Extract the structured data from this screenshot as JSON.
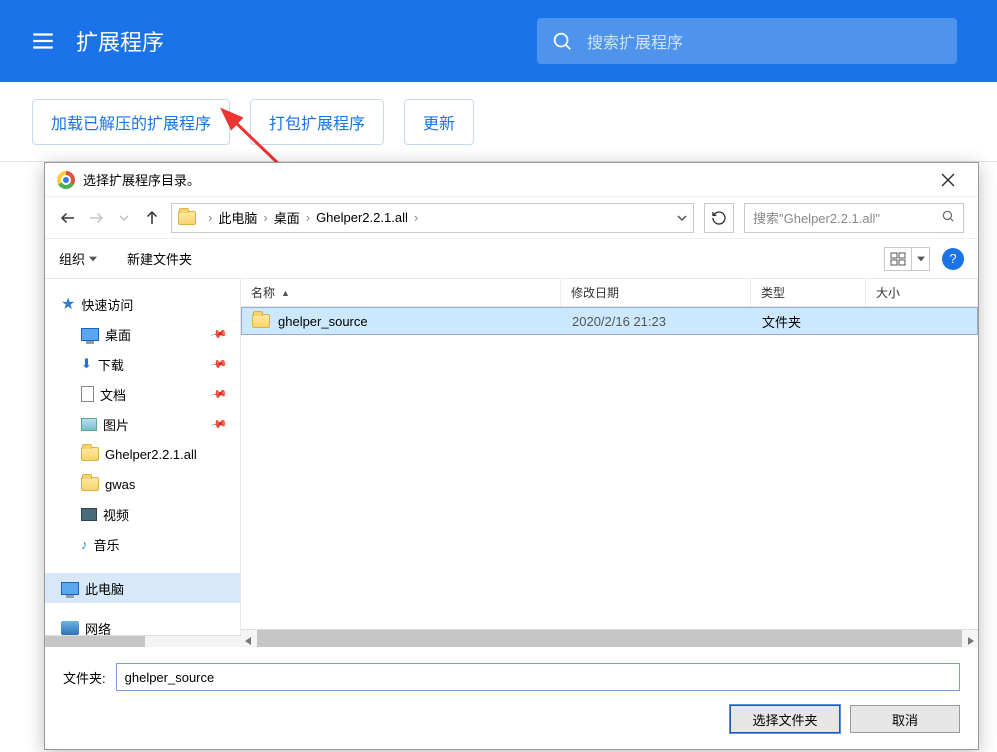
{
  "chrome_bar": {
    "title": "扩展程序",
    "search_placeholder": "搜索扩展程序"
  },
  "ext_toolbar": {
    "load_unpacked": "加载已解压的扩展程序",
    "pack": "打包扩展程序",
    "update": "更新"
  },
  "dialog": {
    "title": "选择扩展程序目录。",
    "breadcrumb": [
      "此电脑",
      "桌面",
      "Ghelper2.2.1.all"
    ],
    "search_placeholder": "搜索\"Ghelper2.2.1.all\"",
    "org": "组织",
    "new_folder": "新建文件夹",
    "help_symbol": "?",
    "tree": {
      "quick": "快速访问",
      "desktop": "桌面",
      "downloads": "下载",
      "docs": "文档",
      "pics": "图片",
      "ghelper": "Ghelper2.2.1.all",
      "gwas": "gwas",
      "video": "视频",
      "music": "音乐",
      "thispc": "此电脑",
      "network": "网络"
    },
    "columns": {
      "name": "名称",
      "date": "修改日期",
      "type": "类型",
      "size": "大小"
    },
    "file": {
      "name": "ghelper_source",
      "date": "2020/2/16 21:23",
      "type": "文件夹"
    },
    "folder_label": "文件夹:",
    "folder_value": "ghelper_source",
    "select_btn": "选择文件夹",
    "cancel_btn": "取消"
  }
}
